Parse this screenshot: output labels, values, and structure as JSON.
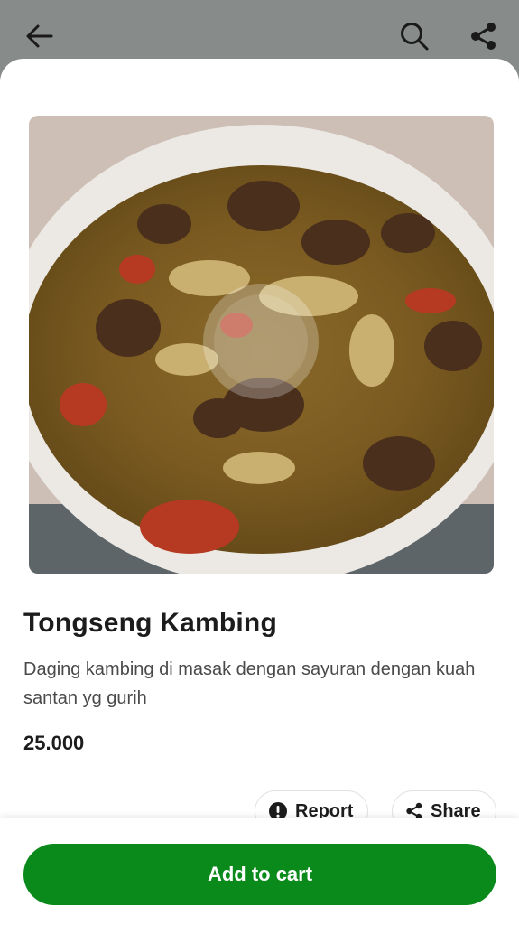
{
  "header": {
    "back_icon": "arrow-left-icon",
    "search_icon": "search-icon",
    "share_icon": "share-icon"
  },
  "product": {
    "image_alt": "Tongseng Kambing",
    "name": "Tongseng Kambing",
    "description": "Daging kambing di masak dengan sayuran dengan kuah santan yg gurih",
    "price": "25.000"
  },
  "actions": {
    "report_label": "Report",
    "share_label": "Share"
  },
  "footer": {
    "add_to_cart_label": "Add to cart"
  },
  "colors": {
    "accent": "#0a8a1a",
    "overlay": "#878b8a"
  }
}
